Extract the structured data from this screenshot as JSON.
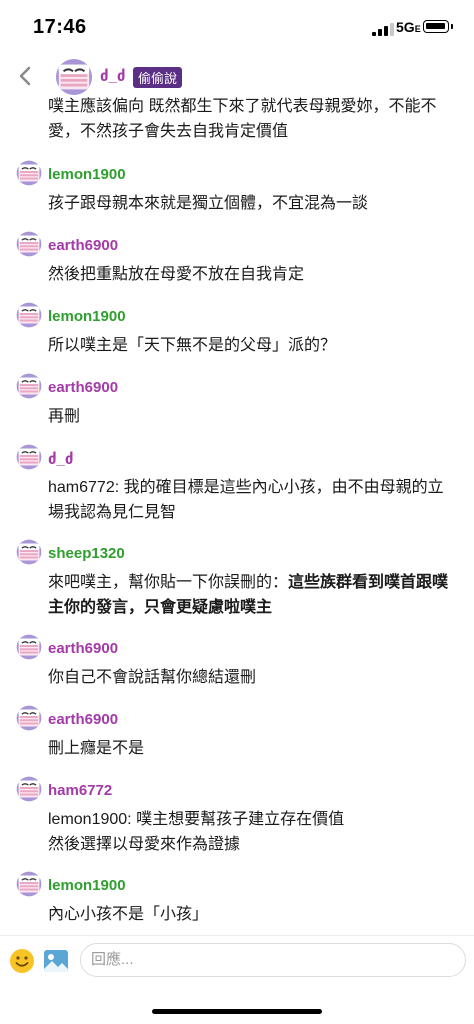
{
  "status": {
    "time": "17:46",
    "network": "5G",
    "network_suffix": "E"
  },
  "op": {
    "name": "ძ_ძ",
    "badge": "偷偷說",
    "text": "噗主應該偏向 既然都生下來了就代表母親愛妳，不能不愛，不然孩子會失去自我肯定價值"
  },
  "messages": [
    {
      "user": "lemon1900",
      "color": "green",
      "text": "孩子跟母親本來就是獨立個體，不宜混為一談"
    },
    {
      "user": "earth6900",
      "color": "purple",
      "text": "然後把重點放在母愛不放在自我肯定"
    },
    {
      "user": "lemon1900",
      "color": "green",
      "text": "所以噗主是「天下無不是的父母」派的？"
    },
    {
      "user": "earth6900",
      "color": "purple",
      "text": "再刪"
    },
    {
      "user": "ძ_ძ",
      "color": "purple",
      "text": "ham6772: 我的確目標是這些內心小孩，由不由母親的立場我認為見仁見智"
    },
    {
      "user": "sheep1320",
      "color": "green",
      "text_pre": "來吧噗主，幫你貼一下你誤刪的：",
      "text_bold": "這些族群看到噗首跟噗主你的發言，只會更疑慮啦噗主"
    },
    {
      "user": "earth6900",
      "color": "purple",
      "text": "你自己不會說話幫你總結還刪"
    },
    {
      "user": "earth6900",
      "color": "purple",
      "text": "刪上癮是不是"
    },
    {
      "user": "ham6772",
      "color": "purple",
      "line1": "lemon1900: 噗主想要幫孩子建立存在價值",
      "line2": "然後選擇以母愛來作為證據"
    },
    {
      "user": "lemon1900",
      "color": "green",
      "text": "內心小孩不是「小孩」"
    }
  ],
  "reply": {
    "placeholder": "回應..."
  },
  "colors": {
    "purple": "#a43aa8",
    "green": "#2f9f2f",
    "badge": "#5b2f86"
  }
}
